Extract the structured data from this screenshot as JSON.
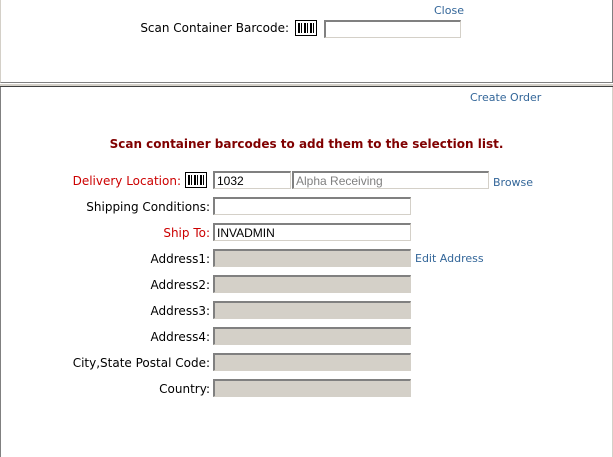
{
  "top": {
    "close_link": "Close",
    "scan_label": "Scan Container Barcode:",
    "scan_value": ""
  },
  "main": {
    "create_order_link": "Create Order",
    "instructions": "Scan container barcodes to add them to the selection list.",
    "delivery": {
      "label": "Delivery Location:",
      "code": "1032",
      "name": "Alpha Receiving",
      "browse_link": "Browse"
    },
    "shipping_conditions": {
      "label": "Shipping Conditions:",
      "value": ""
    },
    "ship_to": {
      "label": "Ship To:",
      "value": "INVADMIN"
    },
    "edit_address_link": "Edit Address",
    "address1": {
      "label": "Address1:",
      "value": ""
    },
    "address2": {
      "label": "Address2:",
      "value": ""
    },
    "address3": {
      "label": "Address3:",
      "value": ""
    },
    "address4": {
      "label": "Address4:",
      "value": ""
    },
    "city_state_postal": {
      "label": "City,State Postal Code:",
      "value": ""
    },
    "country": {
      "label": "Country:",
      "value": ""
    }
  },
  "colors": {
    "required_label": "#cc0000",
    "instructions": "#800000",
    "link": "#336699",
    "readonly_bg": "#d4d0c8"
  }
}
